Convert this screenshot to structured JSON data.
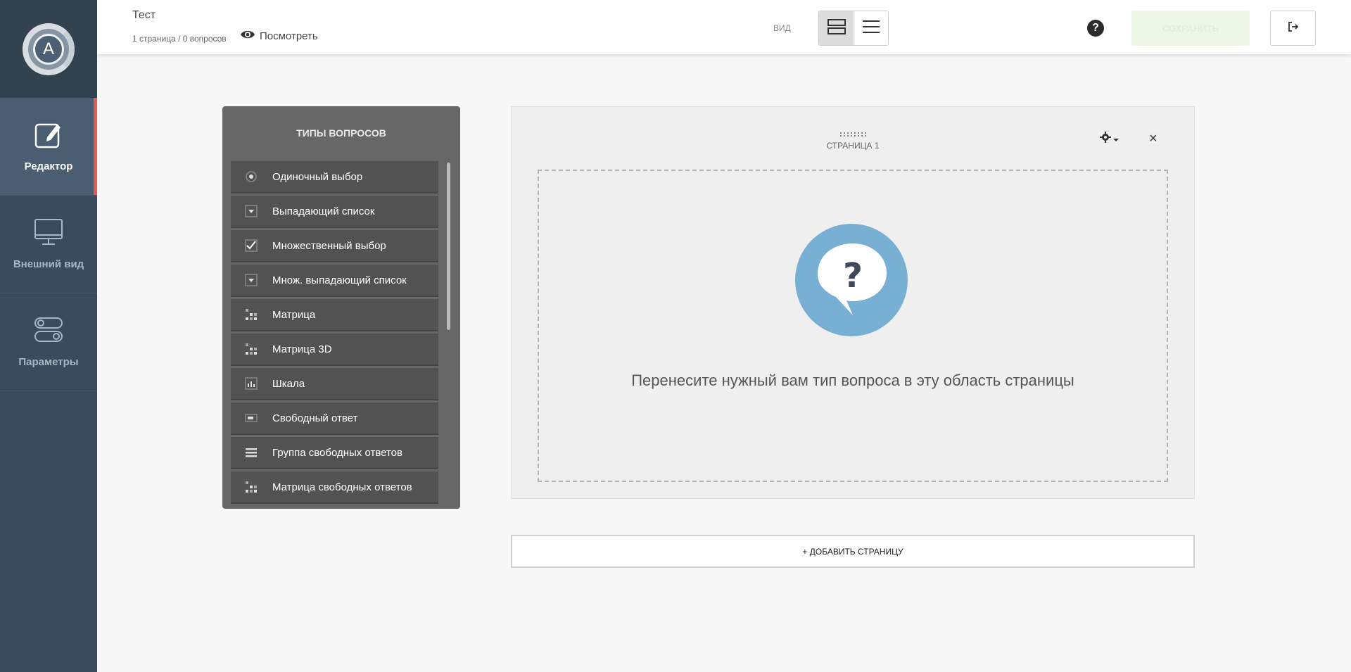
{
  "sidebar": {
    "logo_letter": "A",
    "items": [
      {
        "label": "Редактор",
        "icon": "edit-icon",
        "active": true
      },
      {
        "label": "Внешний вид",
        "icon": "monitor-icon",
        "active": false
      },
      {
        "label": "Параметры",
        "icon": "toggles-icon",
        "active": false
      }
    ]
  },
  "header": {
    "title": "Тест",
    "subtitle": "1 страница / 0 вопросов",
    "preview_label": "Посмотреть",
    "view_label": "ВИД",
    "view_modes": [
      "pages-view",
      "list-view"
    ],
    "help_label": "?",
    "save_label": "СОХРАНИТЬ"
  },
  "question_types": {
    "title": "ТИПЫ ВОПРОСОВ",
    "items": [
      {
        "label": "Одиночный выбор",
        "icon": "radio-icon"
      },
      {
        "label": "Выпадающий список",
        "icon": "dropdown-icon"
      },
      {
        "label": "Множественный выбор",
        "icon": "checkbox-icon"
      },
      {
        "label": "Множ. выпадающий список",
        "icon": "multi-dropdown-icon"
      },
      {
        "label": "Матрица",
        "icon": "matrix-icon"
      },
      {
        "label": "Матрица 3D",
        "icon": "matrix-3d-icon"
      },
      {
        "label": "Шкала",
        "icon": "scale-icon"
      },
      {
        "label": "Свободный ответ",
        "icon": "text-input-icon"
      },
      {
        "label": "Группа свободных ответов",
        "icon": "text-group-icon"
      },
      {
        "label": "Матрица свободных ответов",
        "icon": "text-matrix-icon"
      }
    ]
  },
  "page": {
    "label": "СТРАНИЦА 1",
    "drop_text": "Перенесите нужный вам тип вопроса в эту область страницы",
    "close_label": "×"
  },
  "add_page_label": "+ ДОБАВИТЬ СТРАНИЦУ",
  "colors": {
    "sidebar": "#3a4b5e",
    "active_indicator": "#e05a5a",
    "panel": "#676767",
    "drop_icon": "#78b0d3"
  }
}
